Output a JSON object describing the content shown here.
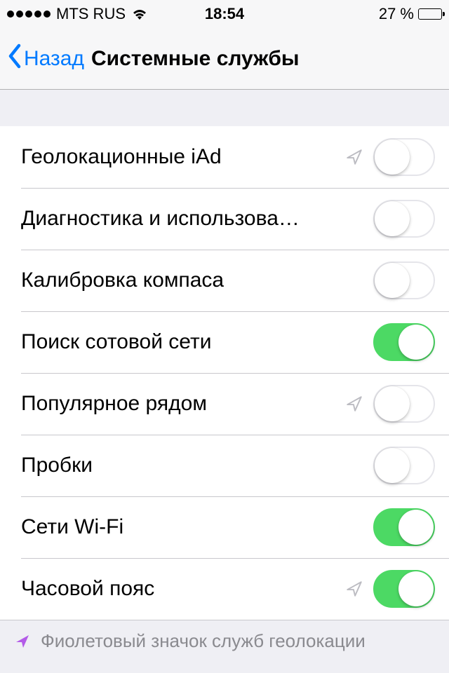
{
  "status": {
    "signal_filled": 5,
    "signal_total": 5,
    "carrier": "MTS RUS",
    "time": "18:54",
    "battery_text": "27 %",
    "battery_level": 27
  },
  "nav": {
    "back_label": "Назад",
    "title": "Системные службы"
  },
  "rows": [
    {
      "label": "Геолокационные iAd",
      "has_arrow": true,
      "on": false
    },
    {
      "label": "Диагностика и использова…",
      "has_arrow": false,
      "on": false
    },
    {
      "label": "Калибровка компаса",
      "has_arrow": false,
      "on": false
    },
    {
      "label": "Поиск сотовой сети",
      "has_arrow": false,
      "on": true
    },
    {
      "label": "Популярное рядом",
      "has_arrow": true,
      "on": false
    },
    {
      "label": "Пробки",
      "has_arrow": false,
      "on": false
    },
    {
      "label": "Сети Wi-Fi",
      "has_arrow": false,
      "on": true
    },
    {
      "label": "Часовой пояс",
      "has_arrow": true,
      "on": true
    }
  ],
  "footer": {
    "text": "Фиолетовый значок служб геолокации"
  },
  "colors": {
    "tint": "#007aff",
    "toggle_on": "#4cd964",
    "arrow_gray": "#bcbcc2",
    "arrow_purple": "#b35be8"
  }
}
